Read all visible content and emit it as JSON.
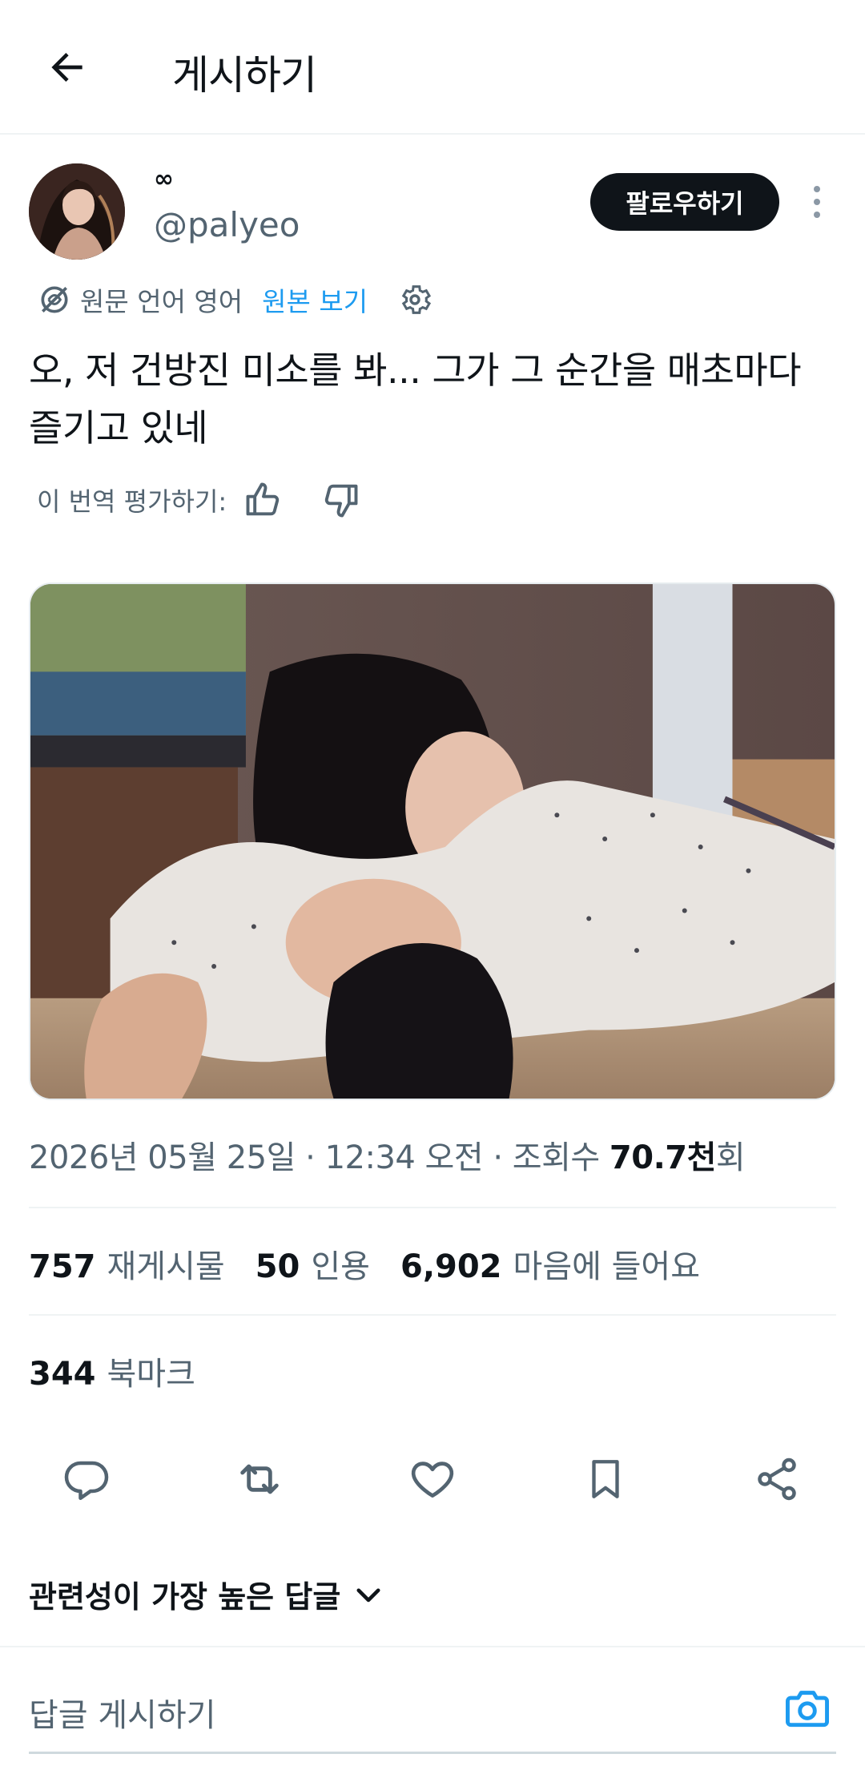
{
  "header": {
    "title": "게시하기",
    "back_icon": "arrow-left-icon"
  },
  "author": {
    "display_name": "∞",
    "handle": "@palyeo",
    "follow_label": "팔로우하기"
  },
  "translation": {
    "source_label": "원문 언어 영어",
    "show_original_label": "원본 보기",
    "rate_label": "이 번역 평가하기:"
  },
  "tweet": {
    "text": "오, 저 건방진 미소를 봐... 그가 그 순간을 매초마다 즐기고 있네"
  },
  "meta": {
    "datetime": "2026년 05월 25일 · 12:34 오전 · 조회수 ",
    "views_value": "70.7천",
    "views_suffix": "회"
  },
  "stats": {
    "reposts_count": "757",
    "reposts_label": "재게시물",
    "quotes_count": "50",
    "quotes_label": "인용",
    "likes_count": "6,902",
    "likes_label": "마음에 들어요",
    "bookmarks_count": "344",
    "bookmarks_label": "북마크"
  },
  "sort": {
    "label": "관련성이 가장 높은 답글"
  },
  "reply": {
    "placeholder": "답글 게시하기"
  },
  "colors": {
    "accent": "#1d9bf0",
    "text": "#0f1419",
    "secondary": "#536471"
  }
}
